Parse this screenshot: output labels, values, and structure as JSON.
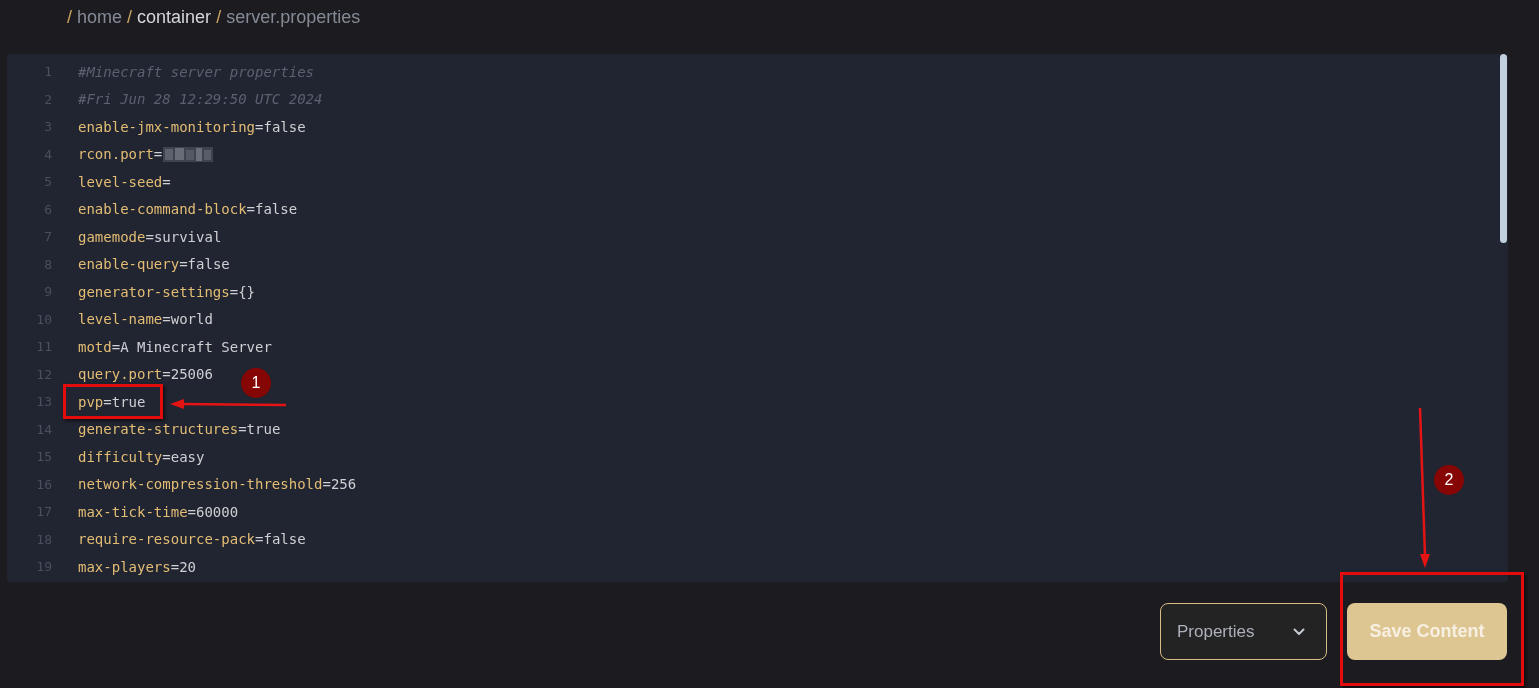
{
  "breadcrumb": [
    {
      "separator": "/",
      "label": "home",
      "hovered": false
    },
    {
      "separator": "/",
      "label": "container",
      "hovered": true
    },
    {
      "separator": "/",
      "label": "server.properties",
      "hovered": false
    }
  ],
  "editor": {
    "lines": [
      {
        "number": "1",
        "kind": "comment",
        "text": "#Minecraft server properties"
      },
      {
        "number": "2",
        "kind": "comment",
        "text": "#Fri Jun 28 12:29:50 UTC 2024"
      },
      {
        "number": "3",
        "kind": "property",
        "key": "enable-jmx-monitoring",
        "operator": "=",
        "value": "false"
      },
      {
        "number": "4",
        "kind": "property",
        "key": "rcon.port",
        "operator": "=",
        "redacted": true
      },
      {
        "number": "5",
        "kind": "property",
        "key": "level-seed",
        "operator": "="
      },
      {
        "number": "6",
        "kind": "property",
        "key": "enable-command-block",
        "operator": "=",
        "value": "false"
      },
      {
        "number": "7",
        "kind": "property",
        "key": "gamemode",
        "operator": "=",
        "value": "survival"
      },
      {
        "number": "8",
        "kind": "property",
        "key": "enable-query",
        "operator": "=",
        "value": "false"
      },
      {
        "number": "9",
        "kind": "property",
        "key": "generator-settings",
        "operator": "=",
        "value": "{}"
      },
      {
        "number": "10",
        "kind": "property",
        "key": "level-name",
        "operator": "=",
        "value": "world"
      },
      {
        "number": "11",
        "kind": "property",
        "key": "motd",
        "operator": "=",
        "value": "A Minecraft Server"
      },
      {
        "number": "12",
        "kind": "property",
        "key": "query.port",
        "operator": "=",
        "value": "25006"
      },
      {
        "number": "13",
        "kind": "property",
        "key": "pvp",
        "operator": "=",
        "value": "true"
      },
      {
        "number": "14",
        "kind": "property",
        "key": "generate-structures",
        "operator": "=",
        "value": "true"
      },
      {
        "number": "15",
        "kind": "property",
        "key": "difficulty",
        "operator": "=",
        "value": "easy"
      },
      {
        "number": "16",
        "kind": "property",
        "key": "network-compression-threshold",
        "operator": "=",
        "value": "256"
      },
      {
        "number": "17",
        "kind": "property",
        "key": "max-tick-time",
        "operator": "=",
        "value": "60000"
      },
      {
        "number": "18",
        "kind": "property",
        "key": "require-resource-pack",
        "operator": "=",
        "value": "false"
      },
      {
        "number": "19",
        "kind": "property",
        "key": "max-players",
        "operator": "=",
        "value": "20"
      }
    ]
  },
  "file_type_select": {
    "value": "Properties"
  },
  "save_button": {
    "label": "Save Content"
  },
  "annotations": [
    {
      "number": "1"
    },
    {
      "number": "2"
    }
  ]
}
